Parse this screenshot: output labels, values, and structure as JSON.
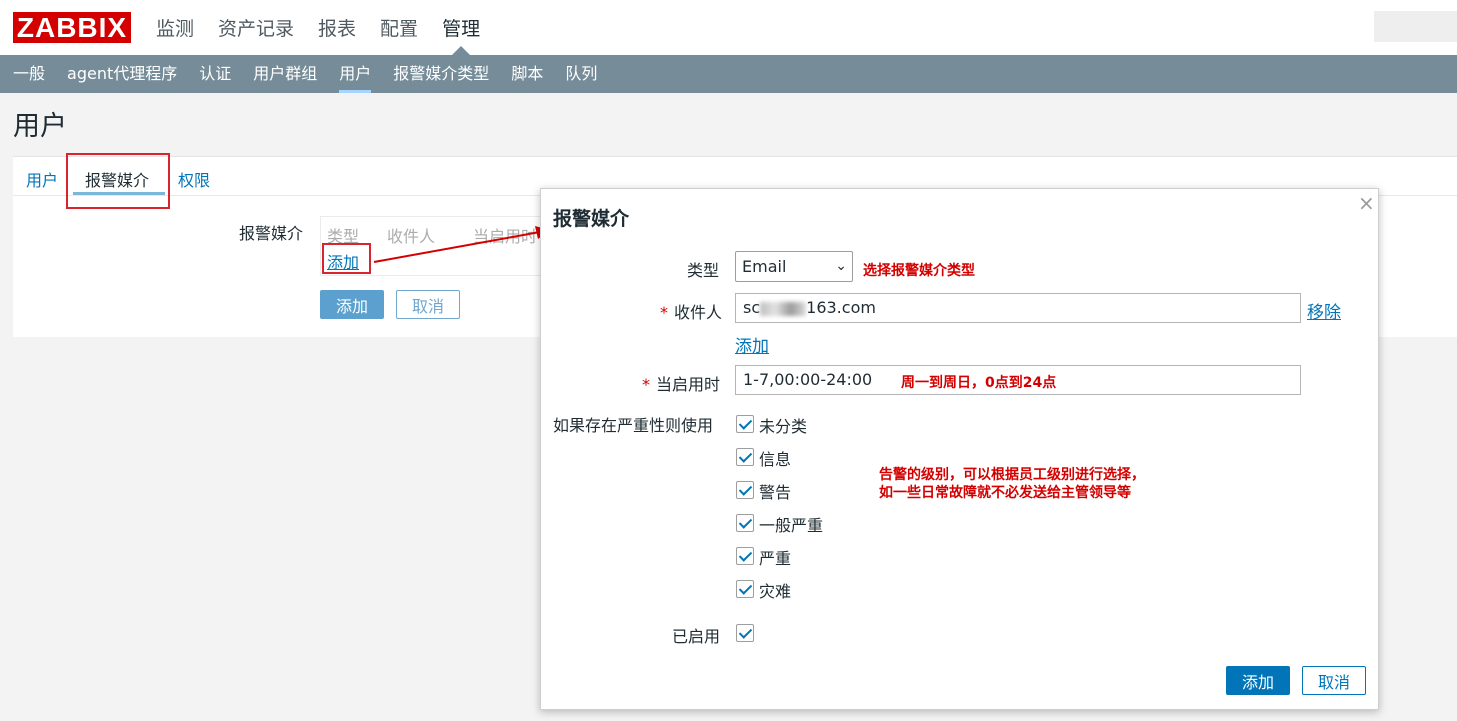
{
  "header": {
    "logo": "ZABBIX",
    "nav": [
      "监测",
      "资产记录",
      "报表",
      "配置",
      "管理"
    ],
    "active_nav": "管理"
  },
  "subnav": {
    "items": [
      "一般",
      "agent代理程序",
      "认证",
      "用户群组",
      "用户",
      "报警媒介类型",
      "脚本",
      "队列"
    ],
    "active": "用户"
  },
  "page": {
    "title": "用户",
    "tabs": [
      "用户",
      "报警媒介",
      "权限"
    ],
    "active_tab": "报警媒介",
    "media_label": "报警媒介",
    "columns": [
      "类型",
      "收件人",
      "当启用时"
    ],
    "add_link": "添加",
    "add_button": "添加",
    "cancel_button": "取消"
  },
  "dialog": {
    "title": "报警媒介",
    "type_label": "类型",
    "type_value": "Email",
    "type_note": "选择报警媒介类型",
    "recipient_label": "收件人",
    "recipient_prefix": "sc",
    "recipient_suffix": "163.com",
    "remove_link": "移除",
    "add_link": "添加",
    "when_active_label": "当启用时",
    "when_active_value": "1-7,00:00-24:00",
    "when_active_note": "周一到周日，0点到24点",
    "severity_label": "如果存在严重性则使用",
    "severities": [
      "未分类",
      "信息",
      "警告",
      "一般严重",
      "严重",
      "灾难"
    ],
    "severity_note_line1": "告警的级别，可以根据员工级别进行选择，",
    "severity_note_line2": "如一些日常故障就不必发送给主管领导等",
    "enabled_label": "已启用",
    "add_button": "添加",
    "cancel_button": "取消"
  },
  "colors": {
    "brand": "#d40000",
    "subnav_bg": "#768d99",
    "primary": "#0275b8",
    "annotation": "#d40000"
  }
}
